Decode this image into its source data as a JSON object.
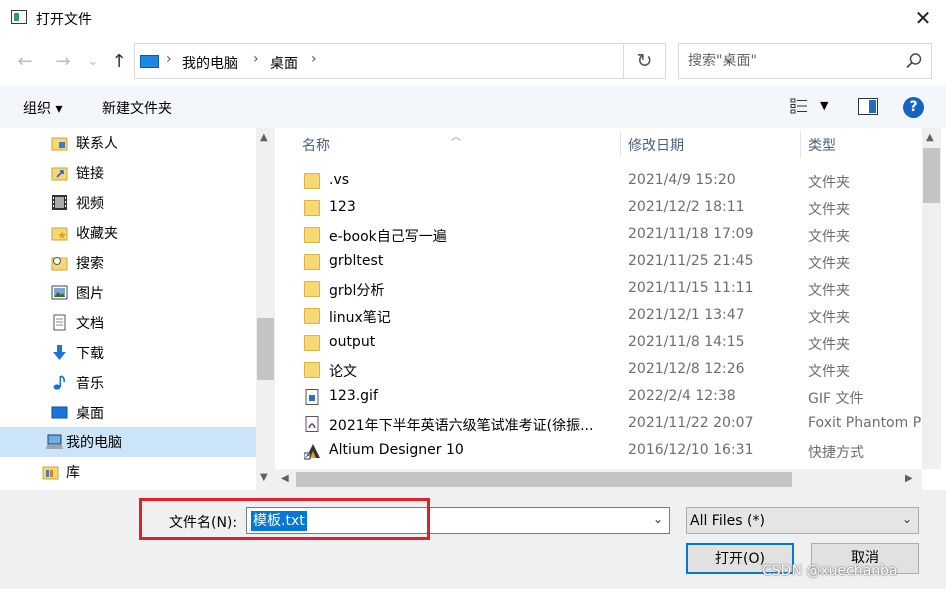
{
  "window": {
    "title": "打开文件",
    "close_glyph": "✕"
  },
  "nav": {
    "back_glyph": "←",
    "forward_glyph": "→",
    "recent_glyph": "⌄",
    "up_glyph": "↑",
    "breadcrumb": [
      "我的电脑",
      "桌面"
    ],
    "refresh_glyph": "↻",
    "search_placeholder": "搜索\"桌面\""
  },
  "toolbar": {
    "organize": "组织 ▾",
    "new_folder": "新建文件夹",
    "help": "?"
  },
  "sidebar": {
    "items": [
      {
        "label": "联系人",
        "icon": "contacts-icon"
      },
      {
        "label": "链接",
        "icon": "link-folder-icon"
      },
      {
        "label": "视频",
        "icon": "video-icon"
      },
      {
        "label": "收藏夹",
        "icon": "favorites-icon"
      },
      {
        "label": "搜索",
        "icon": "search-folder-icon"
      },
      {
        "label": "图片",
        "icon": "pictures-icon"
      },
      {
        "label": "文档",
        "icon": "documents-icon"
      },
      {
        "label": "下载",
        "icon": "download-icon"
      },
      {
        "label": "音乐",
        "icon": "music-icon"
      },
      {
        "label": "桌面",
        "icon": "desktop-icon"
      },
      {
        "label": "我的电脑",
        "icon": "computer-icon",
        "selected": true
      },
      {
        "label": "库",
        "icon": "library-icon"
      }
    ]
  },
  "columns": {
    "name": "名称",
    "date": "修改日期",
    "type": "类型"
  },
  "files": [
    {
      "name": ".vs",
      "date": "2021/4/9 15:20",
      "type": "文件夹",
      "icon": "folder-icon"
    },
    {
      "name": "123",
      "date": "2021/12/2 18:11",
      "type": "文件夹",
      "icon": "folder-icon"
    },
    {
      "name": "e-book自己写一遍",
      "date": "2021/11/18 17:09",
      "type": "文件夹",
      "icon": "folder-icon"
    },
    {
      "name": "grbltest",
      "date": "2021/11/25 21:45",
      "type": "文件夹",
      "icon": "folder-icon"
    },
    {
      "name": "grbl分析",
      "date": "2021/11/15 11:11",
      "type": "文件夹",
      "icon": "folder-icon"
    },
    {
      "name": "linux笔记",
      "date": "2021/12/1 13:47",
      "type": "文件夹",
      "icon": "folder-icon"
    },
    {
      "name": "output",
      "date": "2021/11/8 14:15",
      "type": "文件夹",
      "icon": "folder-icon"
    },
    {
      "name": "论文",
      "date": "2021/12/8 12:26",
      "type": "文件夹",
      "icon": "folder-icon"
    },
    {
      "name": "123.gif",
      "date": "2022/2/4 12:38",
      "type": "GIF 文件",
      "icon": "gif-file-icon"
    },
    {
      "name": "2021年下半年英语六级笔试准考证(徐振...",
      "date": "2021/11/22 20:07",
      "type": "Foxit Phantom P",
      "icon": "pdf-file-icon"
    },
    {
      "name": "Altium Designer 10",
      "date": "2016/12/10 16:31",
      "type": "快捷方式",
      "icon": "shortcut-icon"
    }
  ],
  "bottom": {
    "filename_label": "文件名(N):",
    "filename_value": "模板.txt",
    "filter_value": "All Files (*)",
    "open_label": "打开(O)",
    "cancel_label": "取消"
  },
  "watermark": "CSDN @xuechanba",
  "colors": {
    "selection": "#cce4f7",
    "highlight_box": "#e0202a",
    "accent": "#0078d7",
    "toolbar_bg": "#f3f6fb"
  }
}
